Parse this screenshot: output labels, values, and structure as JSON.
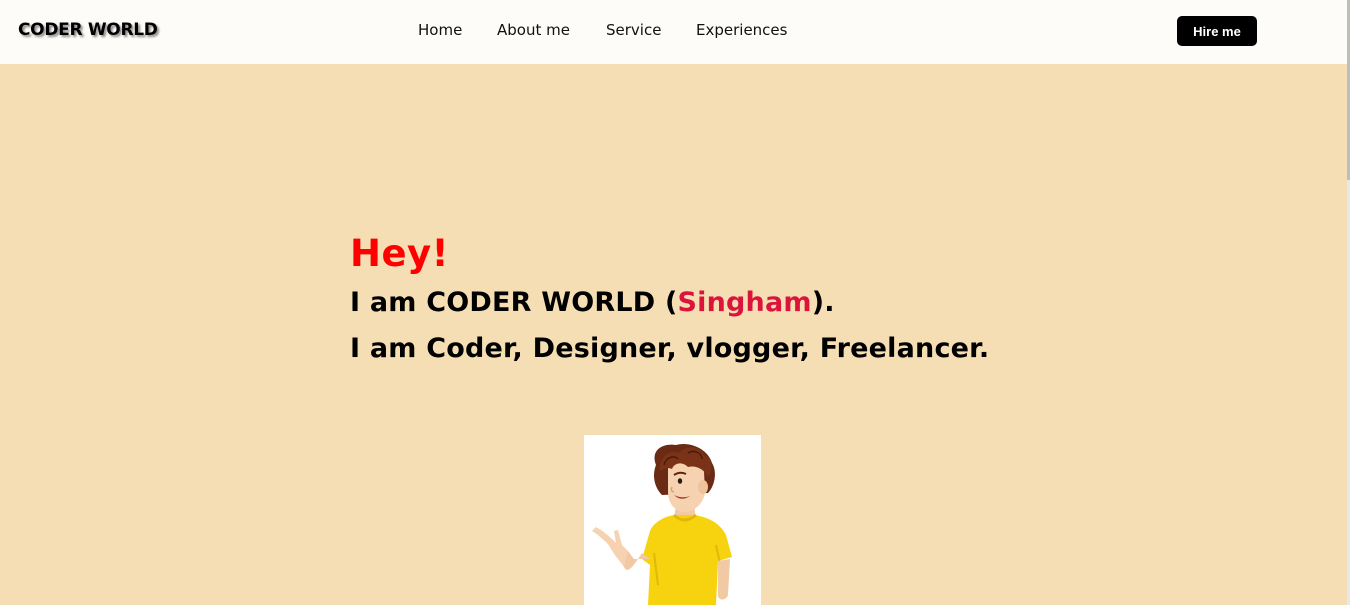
{
  "brand": {
    "text": "CODER WORLD"
  },
  "nav": {
    "items": [
      {
        "label": "Home"
      },
      {
        "label": "About me"
      },
      {
        "label": "Service"
      },
      {
        "label": "Experiences"
      }
    ],
    "cta_label": "Hire me"
  },
  "hero": {
    "greeting": "Hey!",
    "intro_prefix": "I am CODER WORLD (",
    "intro_name": "Singham",
    "intro_suffix": ").",
    "roles": "I am Coder, Designer, vlogger, Freelancer."
  },
  "colors": {
    "page_background": "#f5deb3",
    "navbar_background": "#fdfcf9",
    "greeting": "#ff0000",
    "name_highlight": "#dc143c",
    "button_background": "#000000"
  },
  "illustration": {
    "icon": "boy-presenting-illustration"
  }
}
